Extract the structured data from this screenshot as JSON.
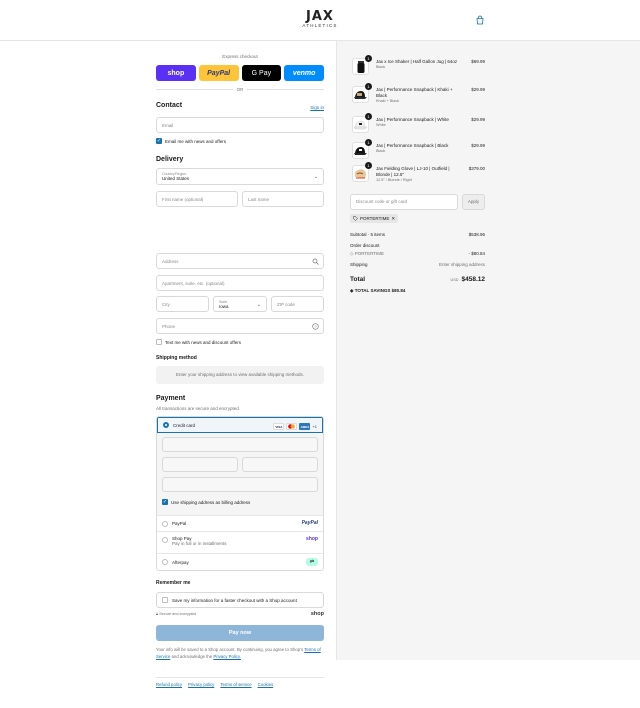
{
  "header": {
    "logo_main": "JAX",
    "logo_sub": "ATHLETICS"
  },
  "express": {
    "title": "Express checkout",
    "shop_label": "shop",
    "paypal_label": "PayPal",
    "gpay_label": "G Pay",
    "venmo_label": "venmo",
    "or_label": "OR"
  },
  "contact": {
    "heading": "Contact",
    "sign_in": "Sign in",
    "email_placeholder": "Email",
    "email_opt_in": "Email me with news and offers"
  },
  "delivery": {
    "heading": "Delivery",
    "country_label": "Country/Region",
    "country_value": "United States",
    "first_name": "First name (optional)",
    "last_name": "Last name",
    "address": "Address",
    "apartment": "Apartment, suite, etc. (optional)",
    "city": "City",
    "state_label": "State",
    "state_value": "Iowa",
    "zip": "ZIP code",
    "phone": "Phone",
    "sms_opt_in": "Text me with news and discount offers"
  },
  "shipping": {
    "heading": "Shipping method",
    "note": "Enter your shipping address to view available shipping methods."
  },
  "payment": {
    "heading": "Payment",
    "subtitle": "All transactions are secure and encrypted.",
    "credit_card": "Credit card",
    "card_visa": "VISA",
    "card_amex": "AMEX",
    "card_more": "+1",
    "billing_same": "Use shipping address as billing address",
    "paypal": "PayPal",
    "paypal_brand": "PayPal",
    "shop_pay": "Shop Pay",
    "shop_pay_desc": "Pay in full or in installments",
    "shop_brand": "shop",
    "afterpay": "Afterpay"
  },
  "remember": {
    "heading": "Remember me",
    "save_info": "Save my information for a faster checkout with a Shop account",
    "secure": "Secure and encrypted",
    "shop_logo": "shop"
  },
  "pay_now": "Pay now",
  "terms": {
    "text_1": "Your info will be saved to a Shop account. By continuing, you agree to Shop's",
    "terms_link": "Terms of Service",
    "text_2": "and acknowledge the",
    "privacy_link": "Privacy Policy."
  },
  "footer_links": [
    "Refund policy",
    "Privacy policy",
    "Terms of service",
    "Cookies"
  ],
  "cart": {
    "items": [
      {
        "qty": "1",
        "name": "Jax x Ice Shaker | Half Gallon Jug | 64oz",
        "variant": "Black",
        "price": "$69.99"
      },
      {
        "qty": "1",
        "name": "Jax | Performance Snapback | Khaki + Black",
        "variant": "Khaki + Black",
        "price": "$29.99"
      },
      {
        "qty": "1",
        "name": "Jax | Performance Snapback | White",
        "variant": "White",
        "price": "$29.99"
      },
      {
        "qty": "1",
        "name": "Jax | Performance Snapback | Black",
        "variant": "Black",
        "price": "$29.99"
      },
      {
        "qty": "1",
        "name": "Jax Fielding Glove | LJ-10 | Outfield | Blonde | 12.5\"",
        "variant": "12.5\" / Blonde / Right",
        "price": "$379.00"
      }
    ],
    "discount_placeholder": "Discount code or gift card",
    "apply": "Apply",
    "applied_code": "PORTERTIME",
    "subtotal_label": "Subtotal · 5 items",
    "subtotal_value": "$538.96",
    "order_discount_label": "Order discount",
    "discount_code": "PORTERTIME",
    "discount_value": "- $80.84",
    "shipping_label": "Shipping",
    "shipping_value": "Enter shipping address",
    "total_label": "Total",
    "currency": "USD",
    "total_value": "$458.12",
    "savings_label": "TOTAL SAVINGS",
    "savings_value": "$80.84"
  },
  "colors": {
    "accent": "#1773b0",
    "pay_now_disabled": "#8db6d8",
    "shop_purple": "#5a31f4",
    "paypal_yellow": "#ffc439",
    "venmo_blue": "#008cff"
  }
}
